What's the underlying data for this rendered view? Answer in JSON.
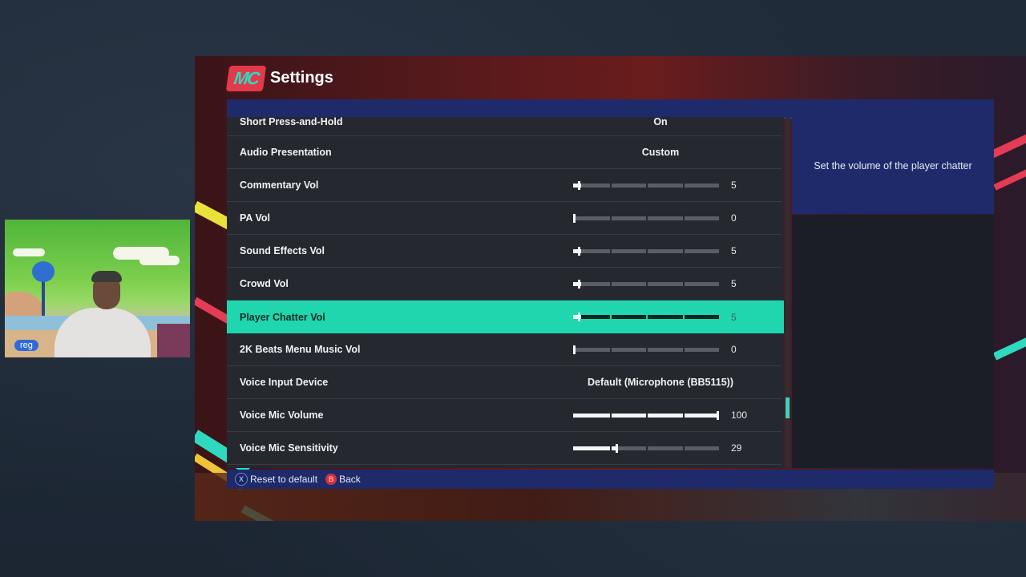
{
  "app": {
    "title": "Settings",
    "logo_text": "MC"
  },
  "rows": [
    {
      "label": "Short Press-and-Hold",
      "type": "value",
      "value": "On"
    },
    {
      "label": "Audio Presentation",
      "type": "value",
      "value": "Custom"
    },
    {
      "label": "Commentary Vol",
      "type": "slider",
      "value": "5",
      "level": 5
    },
    {
      "label": "PA Vol",
      "type": "slider",
      "value": "0",
      "level": 0
    },
    {
      "label": "Sound Effects Vol",
      "type": "slider",
      "value": "5",
      "level": 5
    },
    {
      "label": "Crowd Vol",
      "type": "slider",
      "value": "5",
      "level": 5
    },
    {
      "label": "Player Chatter Vol",
      "type": "slider",
      "value": "5",
      "level": 5,
      "selected": true
    },
    {
      "label": "2K Beats Menu Music Vol",
      "type": "slider",
      "value": "0",
      "level": 0
    },
    {
      "label": "Voice Input Device",
      "type": "value",
      "value": "Default (Microphone (BB5115))"
    },
    {
      "label": "Voice Mic Volume",
      "type": "slider",
      "value": "100",
      "level": 100
    },
    {
      "label": "Voice Mic Sensitivity",
      "type": "slider",
      "value": "29",
      "level": 29
    }
  ],
  "description": "Set the volume of the player chatter",
  "footer": {
    "reset_icon": "X",
    "reset_label": "Reset to default",
    "back_icon": "B",
    "back_label": "Back"
  },
  "webcam": {
    "tag": "reg"
  },
  "colors": {
    "accent": "#1fd6ae",
    "panel_blue": "#1e2a6a",
    "logo_red": "#e23a4b"
  }
}
